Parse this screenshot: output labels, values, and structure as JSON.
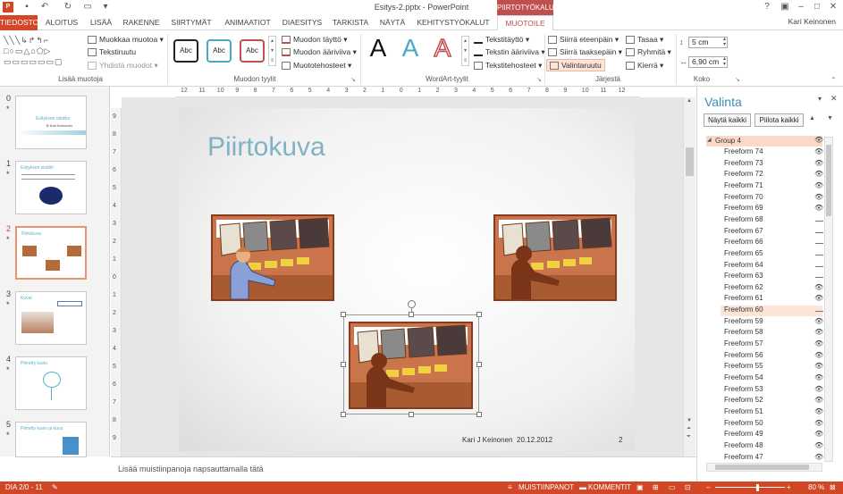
{
  "app": {
    "title": "Esitys-2.pptx - PowerPoint",
    "context_tab": "PIIRTOTYÖKALUT",
    "user": "Kari Keinonen",
    "help": "?"
  },
  "tabs": [
    "TIEDOSTO",
    "ALOITUS",
    "LISÄÄ",
    "RAKENNE",
    "SIIRTYMÄT",
    "ANIMAATIOT",
    "DIAESITYS",
    "TARKISTA",
    "NÄYTÄ",
    "KEHITYSTYÖKALUT",
    "MUOTOILE"
  ],
  "ribbon": {
    "insert_shapes": {
      "edit_shape": "Muokkaa muotoa",
      "text_box": "Tekstiruutu",
      "merge_shapes": "Yhdistä muodot",
      "label": "Lisää muotoja"
    },
    "shape_styles": {
      "samples": [
        "Abc",
        "Abc",
        "Abc"
      ],
      "fill": "Muodon täyttö",
      "outline": "Muodon ääriviiva",
      "effects": "Muototehosteet",
      "label": "Muodon tyylit"
    },
    "wordart": {
      "letter": "A",
      "text_fill": "Tekstitäyttö",
      "text_outline": "Tekstin ääriviiva",
      "text_effects": "Tekstitehosteet",
      "label": "WordArt-tyylit"
    },
    "arrange": {
      "bring_forward": "Siirrä eteenpäin",
      "send_backward": "Siirrä taaksepäin",
      "selection_pane": "Valintaruutu",
      "align": "Tasaa",
      "group": "Ryhmitä",
      "rotate": "Kierrä",
      "label": "Järjestä"
    },
    "size": {
      "height": "5 cm",
      "width": "6,90 cm",
      "label": "Koko"
    }
  },
  "slides": [
    {
      "num": "0",
      "star": "*",
      "title": "Esityksen otsikko",
      "subtitle": "B Kari Keinonen"
    },
    {
      "num": "1",
      "star": "*",
      "title": "Esityksen sisältö",
      "subtitle": ""
    },
    {
      "num": "2",
      "star": "*",
      "title": "Piirtokuva",
      "subtitle": ""
    },
    {
      "num": "3",
      "star": "*",
      "title": "Kuvat",
      "subtitle": ""
    },
    {
      "num": "4",
      "star": "*",
      "title": "Piirretty kuvio",
      "subtitle": ""
    },
    {
      "num": "5",
      "star": "*",
      "title": "Piirretty kuvio ja kuva",
      "subtitle": ""
    }
  ],
  "ruler": {
    "h_ticks": [
      "12",
      "11",
      "10",
      "9",
      "8",
      "7",
      "6",
      "5",
      "4",
      "3",
      "2",
      "1",
      "0",
      "1",
      "2",
      "3",
      "4",
      "5",
      "6",
      "7",
      "8",
      "9",
      "10",
      "11",
      "12"
    ],
    "v_ticks": [
      "9",
      "8",
      "7",
      "6",
      "5",
      "4",
      "3",
      "2",
      "1",
      "0",
      "1",
      "2",
      "3",
      "4",
      "5",
      "6",
      "7",
      "8",
      "9"
    ]
  },
  "slide": {
    "title": "Piirtokuva",
    "author": "Kari J Keinonen",
    "date": "20.12.2012",
    "number": "2"
  },
  "notes": {
    "placeholder": "Lisää muistiinpanoja napsauttamalla tätä"
  },
  "pane": {
    "title": "Valinta",
    "show_all": "Näytä kaikki",
    "hide_all": "Piilota kaikki",
    "group": "Group 4",
    "items": [
      {
        "name": "Freeform 74",
        "visible": true
      },
      {
        "name": "Freeform 73",
        "visible": true
      },
      {
        "name": "Freeform 72",
        "visible": true
      },
      {
        "name": "Freeform 71",
        "visible": true
      },
      {
        "name": "Freeform 70",
        "visible": true
      },
      {
        "name": "Freeform 69",
        "visible": true
      },
      {
        "name": "Freeform 68",
        "visible": false
      },
      {
        "name": "Freeform 67",
        "visible": false
      },
      {
        "name": "Freeform 66",
        "visible": false
      },
      {
        "name": "Freeform 65",
        "visible": false
      },
      {
        "name": "Freeform 64",
        "visible": false
      },
      {
        "name": "Freeform 63",
        "visible": false
      },
      {
        "name": "Freeform 62",
        "visible": true
      },
      {
        "name": "Freeform 61",
        "visible": true
      },
      {
        "name": "Freeform 60",
        "visible": false
      },
      {
        "name": "Freeform 59",
        "visible": true
      },
      {
        "name": "Freeform 58",
        "visible": true
      },
      {
        "name": "Freeform 57",
        "visible": true
      },
      {
        "name": "Freeform 56",
        "visible": true
      },
      {
        "name": "Freeform 55",
        "visible": true
      },
      {
        "name": "Freeform 54",
        "visible": true
      },
      {
        "name": "Freeform 53",
        "visible": true
      },
      {
        "name": "Freeform 52",
        "visible": true
      },
      {
        "name": "Freeform 51",
        "visible": true
      },
      {
        "name": "Freeform 50",
        "visible": true
      },
      {
        "name": "Freeform 49",
        "visible": true
      },
      {
        "name": "Freeform 48",
        "visible": true
      },
      {
        "name": "Freeform 47",
        "visible": true
      }
    ]
  },
  "status": {
    "slide": "DIA 2/0 - 11",
    "notes": "MUISTIINPANOT",
    "comments": "KOMMENTIT",
    "zoom": "80 %"
  },
  "colors": {
    "accent": "#d24726",
    "title": "#7fb3c4",
    "pane_title": "#3a8fb5",
    "selected_row": "#fbd9c9",
    "selected_item": "#fce4d8"
  }
}
